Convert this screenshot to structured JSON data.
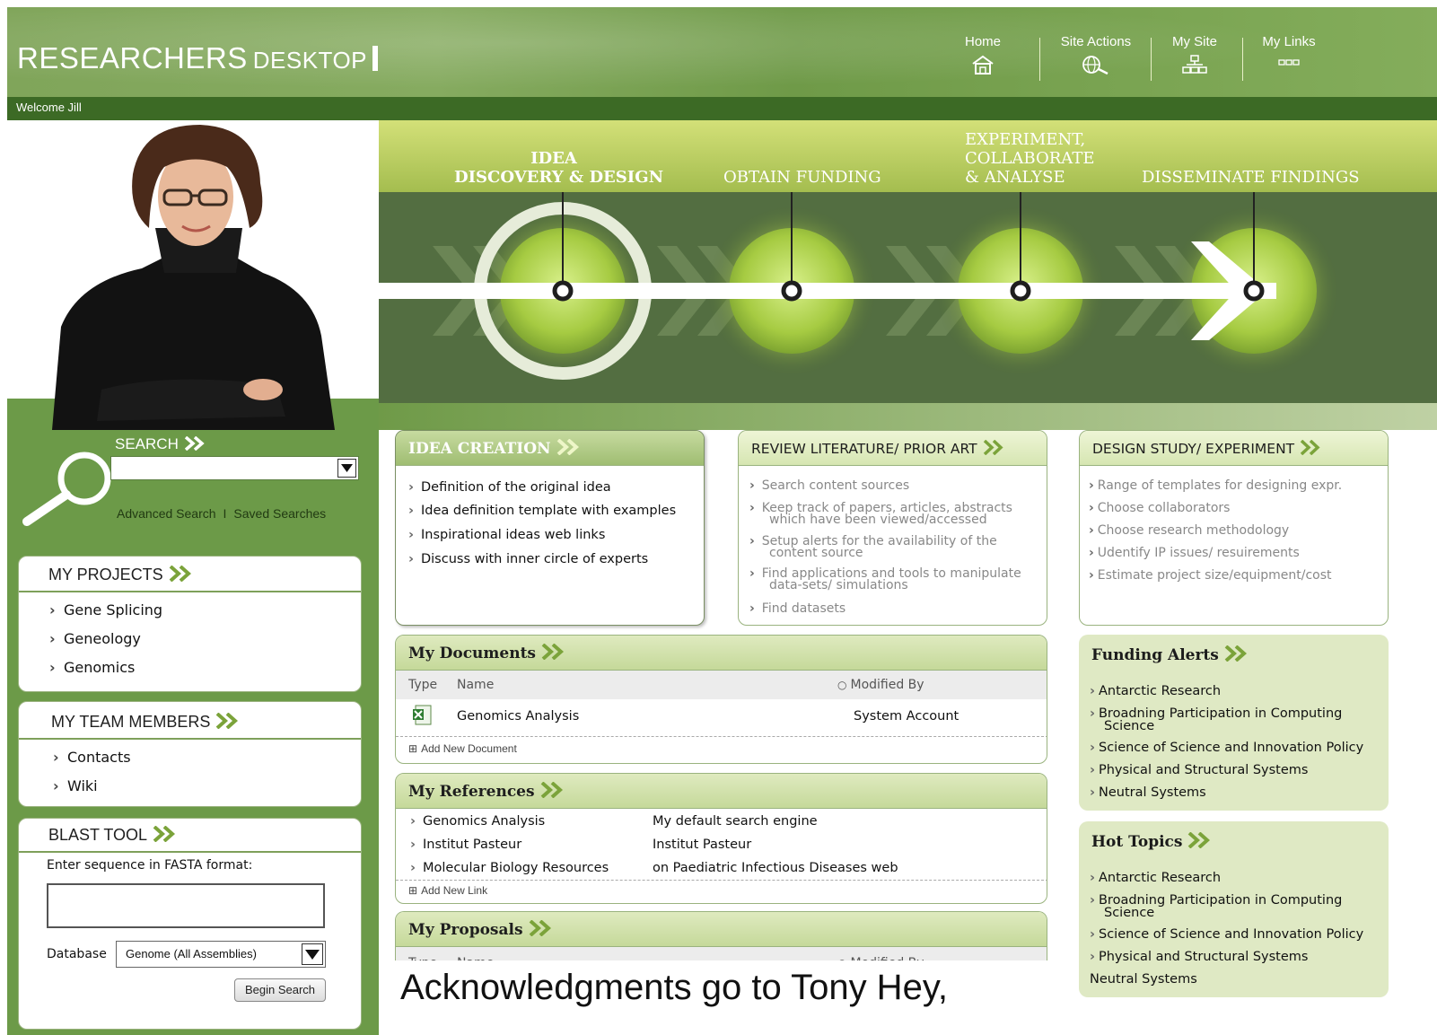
{
  "header": {
    "title_main": "RESEARCHERS",
    "title_sub": "DESKTOP",
    "nav": [
      {
        "label": "Home",
        "icon": "home-icon"
      },
      {
        "label": "Site Actions",
        "icon": "globe-search-icon"
      },
      {
        "label": "My Site",
        "icon": "sitemap-icon"
      },
      {
        "label": "My Links",
        "icon": "links-icon"
      }
    ],
    "welcome": "Welcome Jill"
  },
  "hero": {
    "stages": [
      {
        "line1": "IDEA",
        "line2": "DISCOVERY & DESIGN"
      },
      {
        "line1": "",
        "line2": "OBTAIN FUNDING"
      },
      {
        "line1": "EXPERIMENT,",
        "line1b": "COLLABORATE",
        "line2": "& ANALYSE"
      },
      {
        "line1": "",
        "line2": "DISSEMINATE FINDINGS"
      }
    ],
    "active_stage": 0
  },
  "search": {
    "title": "SEARCH",
    "value": "",
    "advanced": "Advanced Search",
    "separator": "I",
    "saved": "Saved Searches"
  },
  "my_projects": {
    "title": "MY PROJECTS",
    "items": [
      "Gene Splicing",
      "Geneology",
      "Genomics"
    ]
  },
  "my_team": {
    "title": "MY TEAM MEMBERS",
    "items": [
      "Contacts",
      "Wiki"
    ]
  },
  "blast": {
    "title": "BLAST TOOL",
    "instruction": "Enter sequence in FASTA format:",
    "sequence": "",
    "db_label": "Database",
    "db_value": "Genome (All Assemblies)",
    "button": "Begin Search"
  },
  "idea_creation": {
    "title": "IDEA CREATION",
    "items": [
      "Definition of the original idea",
      "Idea definition template with examples",
      "Inspirational ideas web links",
      "Discuss with inner circle of experts"
    ]
  },
  "review_literature": {
    "title": "REVIEW LITERATURE/ PRIOR ART",
    "items": [
      [
        "Search content sources"
      ],
      [
        "Keep track of papers, articles, abstracts",
        "which have been viewed/accessed"
      ],
      [
        "Setup alerts for the availability of the",
        "content source"
      ],
      [
        "Find applications and tools to manipulate",
        "data-sets/ simulations"
      ],
      [
        "Find datasets"
      ]
    ]
  },
  "design_study": {
    "title": "DESIGN STUDY/ EXPERIMENT",
    "items": [
      "Range of templates for designing expr.",
      "Choose collaborators",
      "Choose research methodology",
      "Udentify IP issues/ resuirements",
      "Estimate project size/equipment/cost"
    ]
  },
  "my_documents": {
    "title": "My Documents",
    "columns": [
      "Type",
      "Name",
      "Modified By"
    ],
    "rows": [
      {
        "name": "Genomics Analysis",
        "modified_by": "System Account"
      }
    ],
    "add_link": "Add New Document"
  },
  "my_references": {
    "title": "My References",
    "rows": [
      {
        "name": "Genomics Analysis",
        "desc": "My default search engine"
      },
      {
        "name": "Institut Pasteur",
        "desc": "Institut Pasteur"
      },
      {
        "name": "Molecular Biology Resources",
        "desc": "on Paediatric Infectious Diseases web"
      }
    ],
    "add_link": "Add New Link"
  },
  "my_proposals": {
    "title": "My Proposals",
    "columns": [
      "Type",
      "Name",
      "Modified By"
    ]
  },
  "funding_alerts": {
    "title": "Funding Alerts",
    "items": [
      [
        "Antarctic Research"
      ],
      [
        "Broadning Participation in Computing",
        "Science"
      ],
      [
        "Science of Science and Innovation Policy"
      ],
      [
        "Physical and Structural Systems"
      ],
      [
        "Neutral Systems"
      ]
    ]
  },
  "hot_topics": {
    "title": "Hot Topics",
    "items": [
      [
        "Antarctic Research"
      ],
      [
        "Broadning Participation in Computing",
        "Science"
      ],
      [
        "Science of Science and Innovation Policy"
      ],
      [
        "Physical and Structural Systems"
      ],
      [
        "Neutral Systems"
      ]
    ]
  },
  "caption": "Acknowledgments go to Tony Hey,",
  "colors": {
    "header_green": "#80a55a",
    "dark_green": "#3c6a25",
    "panel_border": "#9ab37f",
    "side_panel_bg": "#dfe9c4"
  }
}
